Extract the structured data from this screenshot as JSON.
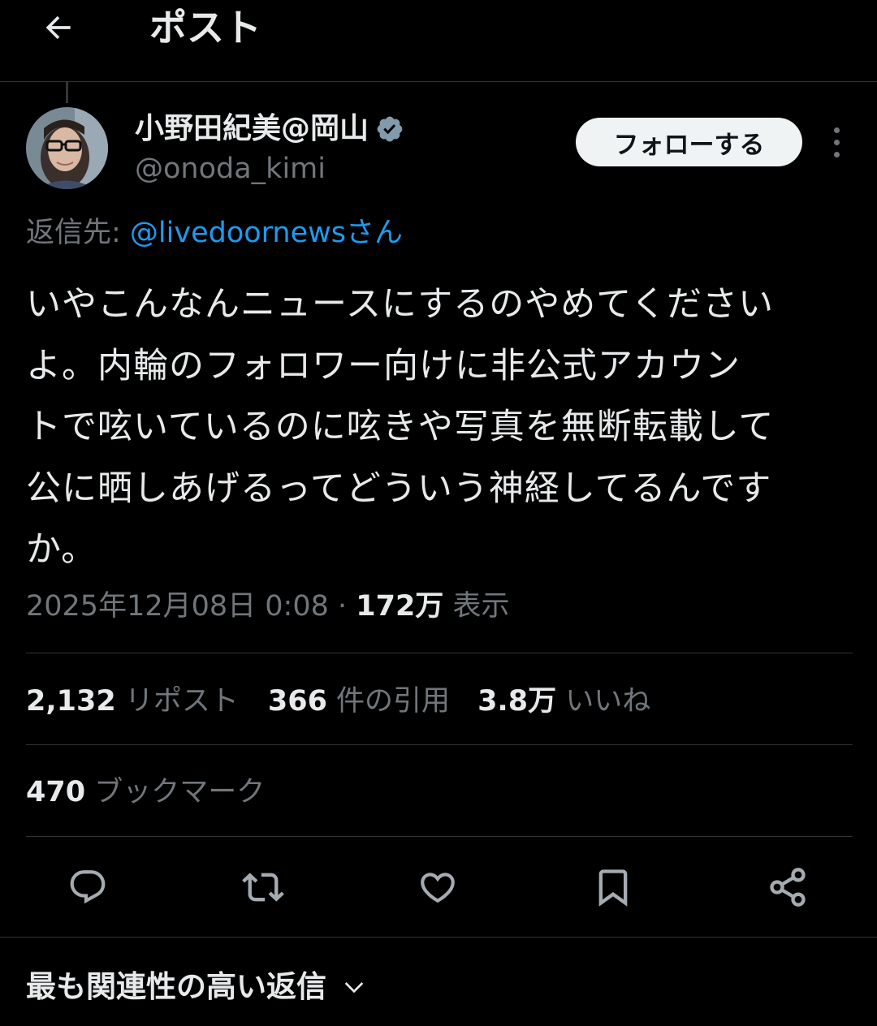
{
  "header": {
    "title": "ポスト"
  },
  "author": {
    "display_name": "小野田紀美@岡山",
    "handle": "@onoda_kimi",
    "follow_label": "フォローする"
  },
  "reply_to": {
    "prefix": "返信先: ",
    "mention": "@livedoornewsさん"
  },
  "tweet": {
    "lines": [
      "いやこんなんニュースにするのやめてください",
      "よ。内輪のフォロワー向けに非公式アカウン",
      "トで呟いているのに呟きや写真を無断転載して",
      "公に晒しあげるってどういう神経してるんです",
      "か。"
    ]
  },
  "meta": {
    "timestamp": "2025年12月08日 0:08 · ",
    "views": "172万",
    "views_label": " 表示"
  },
  "stats": {
    "reposts": "2,132",
    "reposts_label": " リポスト",
    "quotes": "366",
    "quotes_label": " 件の引用",
    "likes": "3.8万",
    "likes_label": " いいね",
    "bookmarks": "470",
    "bookmarks_label": " ブックマーク"
  },
  "actions": [
    "reply-icon",
    "repost-icon",
    "like-icon",
    "bookmark-icon",
    "share-icon"
  ],
  "replies_sort": {
    "label": "最も関連性の高い返信"
  },
  "colors": {
    "background": "#000000",
    "text": "#e7e9ea",
    "secondary": "#71767b",
    "link": "#1d9bf0",
    "verified": "#829aab",
    "divider": "#2f3336"
  }
}
